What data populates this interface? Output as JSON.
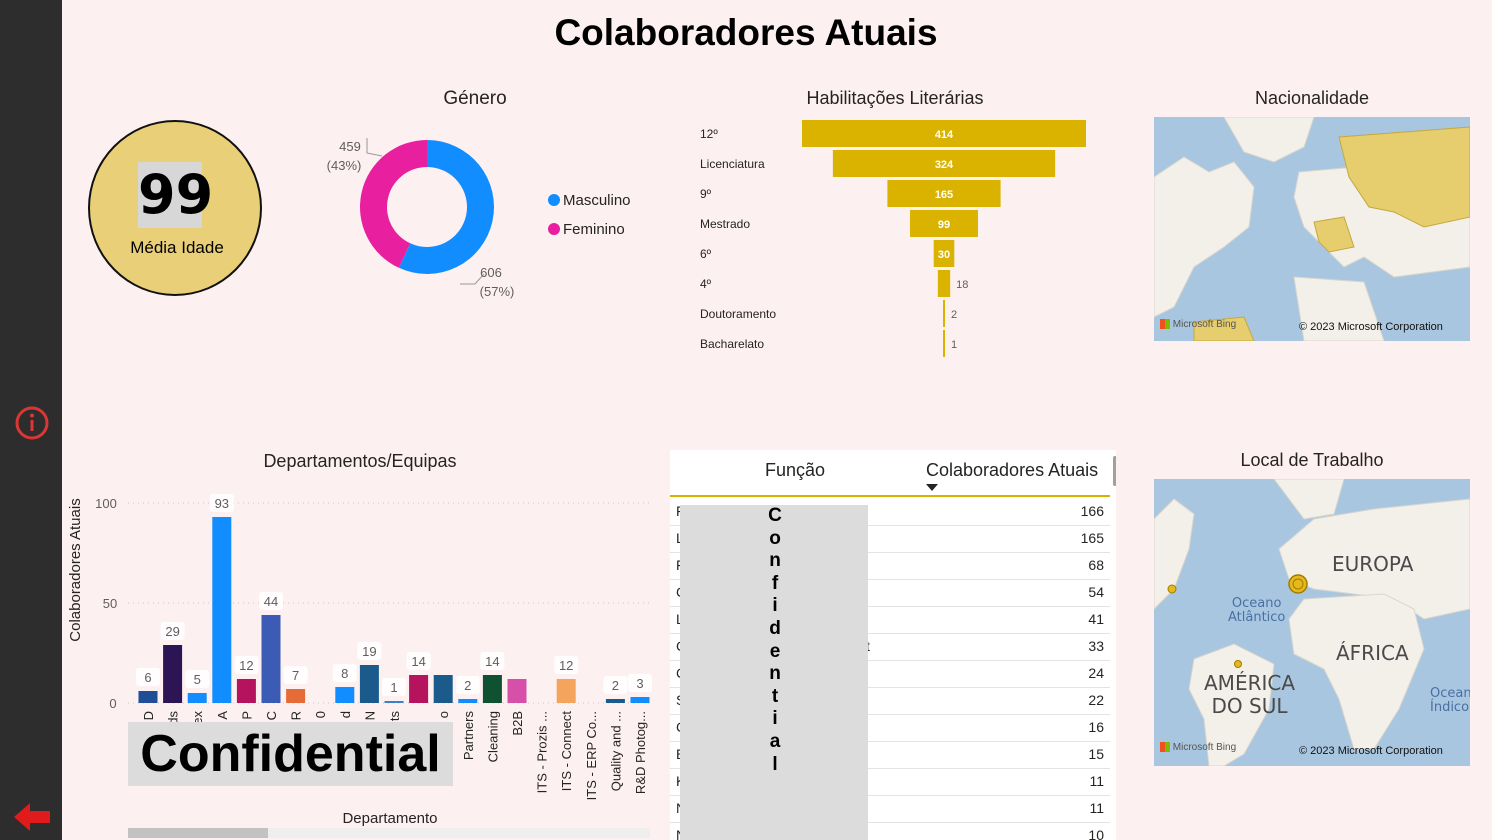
{
  "page": {
    "title": "Colaboradores Atuais"
  },
  "age_card": {
    "value": "99",
    "label": "Média Idade"
  },
  "gender": {
    "title": "Género",
    "legend": [
      {
        "label": "Masculino",
        "color": "#118dff"
      },
      {
        "label": "Feminino",
        "color": "#e8209f"
      }
    ],
    "slices": [
      {
        "name": "Masculino",
        "value": 606,
        "value_label": "606",
        "pct_label": "(57%)",
        "color": "#118dff"
      },
      {
        "name": "Feminino",
        "value": 459,
        "value_label": "459",
        "pct_label": "(43%)",
        "color": "#e8209f"
      }
    ]
  },
  "education": {
    "title": "Habilitações Literárias",
    "color": "#d9b300",
    "max": 414,
    "items": [
      {
        "label": "12º",
        "value": 414
      },
      {
        "label": "Licenciatura",
        "value": 324
      },
      {
        "label": "9º",
        "value": 165
      },
      {
        "label": "Mestrado",
        "value": 99
      },
      {
        "label": "6º",
        "value": 30
      },
      {
        "label": "4º",
        "value": 18
      },
      {
        "label": "Doutoramento",
        "value": 2
      },
      {
        "label": "Bacharelato",
        "value": 1
      }
    ]
  },
  "nationality_map": {
    "title": "Nacionalidade",
    "bing": "Microsoft Bing",
    "copyright": "© 2023 Microsoft Corporation"
  },
  "workplace_map": {
    "title": "Local de Trabalho",
    "bing": "Microsoft Bing",
    "copyright": "© 2023 Microsoft Corporation",
    "labels": {
      "europa": "EUROPA",
      "oceano_line1": "Oceano",
      "oceano_line2": "Atlântico",
      "africa": "ÁFRICA",
      "america_line1": "AMÉRICA",
      "america_line2": "DO SUL",
      "oceano_indico_line1": "Ocean",
      "oceano_indico_line2": "Índico"
    }
  },
  "departments": {
    "title": "Departamentos/Equipas",
    "xlabel": "Departamento",
    "ylabel": "Colaboradores Atuais",
    "yticks": [
      "100",
      "50",
      "0"
    ]
  },
  "chart_data": {
    "type": "bar",
    "title": "Departamentos/Equipas",
    "xlabel": "Departamento",
    "ylabel": "Colaboradores Atuais",
    "ylim": [
      0,
      100
    ],
    "grid": true,
    "categories": [
      "D",
      "ds",
      "ex",
      "A",
      "P",
      "C",
      "R",
      "0",
      "d",
      "N",
      "ts",
      "",
      "o",
      "Partners",
      "Cleaning",
      "B2B",
      "ITS - Prozis ...",
      "ITS - Connect",
      "ITS - ERP Co...",
      "Quality and ...",
      "R&D Photog..."
    ],
    "values": [
      6,
      29,
      5,
      93,
      12,
      44,
      7,
      0,
      8,
      19,
      1,
      14,
      14,
      2,
      14,
      12,
      0,
      12,
      0,
      2,
      3
    ],
    "colors": [
      "#1f4e96",
      "#2d1454",
      "#118dff",
      "#118dff",
      "#b5135e",
      "#3b5bb5",
      "#e66c37",
      "#118dff",
      "#118dff",
      "#1a5b8c",
      "#3b82c4",
      "#b5135e",
      "#1a5b8c",
      "#118dff",
      "#0f5130",
      "#d64fa8",
      "#118dff",
      "#f5a45e",
      "#118dff",
      "#1a5b8c",
      "#118dff"
    ],
    "data_labels": [
      "6",
      "29",
      "5",
      "93",
      "12",
      "44",
      "7",
      "",
      "8",
      "19",
      "1",
      "14",
      "",
      "2",
      "14",
      "",
      "",
      "12",
      "",
      "2",
      "3"
    ]
  },
  "table": {
    "headers": [
      "Função",
      "Colaboradores Atuais"
    ],
    "rows": [
      {
        "funcao": "F",
        "valor": "166"
      },
      {
        "funcao": "L",
        "valor": "165"
      },
      {
        "funcao": "F",
        "valor": "68"
      },
      {
        "funcao": "C",
        "valor": "54"
      },
      {
        "funcao": "L",
        "valor": "41"
      },
      {
        "funcao": "C",
        "valor": "33",
        "tail": "t"
      },
      {
        "funcao": "C",
        "valor": "24"
      },
      {
        "funcao": "S",
        "valor": "22"
      },
      {
        "funcao": "C",
        "valor": "16"
      },
      {
        "funcao": "E",
        "valor": "15"
      },
      {
        "funcao": "K",
        "valor": "11"
      },
      {
        "funcao": "N",
        "valor": "11"
      },
      {
        "funcao": "N",
        "valor": "10"
      }
    ]
  },
  "redactions": {
    "horizontal": "Confidential",
    "vertical_letters": [
      "C",
      "o",
      "n",
      "f",
      "i",
      "d",
      "e",
      "n",
      "t",
      "i",
      "a",
      "l"
    ]
  }
}
